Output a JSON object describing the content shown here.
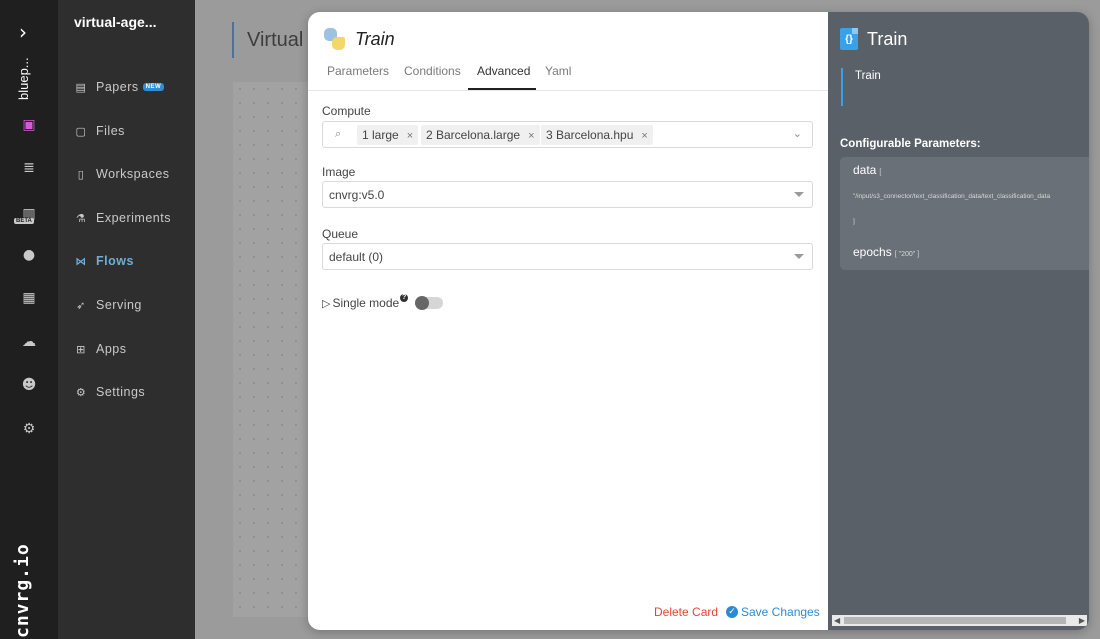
{
  "rail": {
    "project_short": "bluep...",
    "brand": "cnvrg.io",
    "beta": "BETA"
  },
  "nav": {
    "project_title": "virtual-age...",
    "items": [
      {
        "label": "Papers",
        "icon": "newspaper-icon",
        "badge": "NEW"
      },
      {
        "label": "Files",
        "icon": "file-icon"
      },
      {
        "label": "Workspaces",
        "icon": "workspace-icon"
      },
      {
        "label": "Experiments",
        "icon": "flask-icon"
      },
      {
        "label": "Flows",
        "icon": "flow-icon",
        "active": true
      },
      {
        "label": "Serving",
        "icon": "rocket-icon"
      },
      {
        "label": "Apps",
        "icon": "grid-icon"
      },
      {
        "label": "Settings",
        "icon": "gear-icon"
      }
    ]
  },
  "canvas": {
    "title": "Virtual"
  },
  "modal": {
    "title": "Train",
    "tabs": [
      "Parameters",
      "Conditions",
      "Advanced",
      "Yaml"
    ],
    "active_tab": "Advanced",
    "compute": {
      "label": "Compute",
      "chips": [
        "1 large",
        "2 Barcelona.large",
        "3 Barcelona.hpu"
      ]
    },
    "image": {
      "label": "Image",
      "value": "cnvrg:v5.0"
    },
    "queue": {
      "label": "Queue",
      "value": "default (0)"
    },
    "single_mode": {
      "label": "Single mode",
      "help": "?",
      "enabled": false
    },
    "delete_label": "Delete Card",
    "save_label": "Save Changes"
  },
  "side": {
    "title": "Train",
    "description": "Train",
    "configurable_label": "Configurable Parameters:",
    "params": [
      {
        "name": "data",
        "open": "[",
        "value": "\"/input/s3_connector/text_classification_data/text_classification_data",
        "close": "]"
      },
      {
        "name": "epochs",
        "inline": "[ \"200\" ]"
      }
    ]
  },
  "colors": {
    "accent": "#2b8ad6",
    "danger": "#e8413a",
    "nav_active": "#6eaed5",
    "rail_active": "#d55ad5"
  }
}
